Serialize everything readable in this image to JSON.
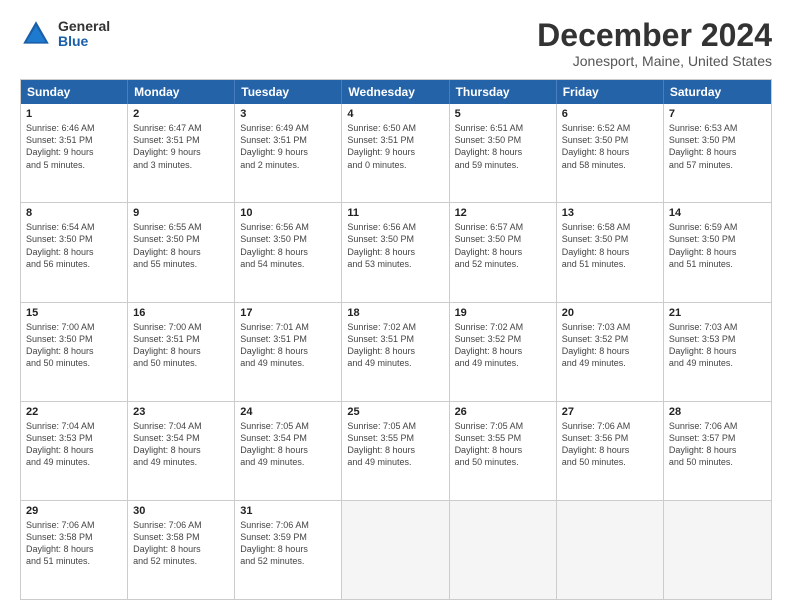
{
  "logo": {
    "general": "General",
    "blue": "Blue"
  },
  "title": "December 2024",
  "subtitle": "Jonesport, Maine, United States",
  "days": [
    "Sunday",
    "Monday",
    "Tuesday",
    "Wednesday",
    "Thursday",
    "Friday",
    "Saturday"
  ],
  "weeks": [
    [
      {
        "day": "1",
        "text": "Sunrise: 6:46 AM\nSunset: 3:51 PM\nDaylight: 9 hours\nand 5 minutes."
      },
      {
        "day": "2",
        "text": "Sunrise: 6:47 AM\nSunset: 3:51 PM\nDaylight: 9 hours\nand 3 minutes."
      },
      {
        "day": "3",
        "text": "Sunrise: 6:49 AM\nSunset: 3:51 PM\nDaylight: 9 hours\nand 2 minutes."
      },
      {
        "day": "4",
        "text": "Sunrise: 6:50 AM\nSunset: 3:51 PM\nDaylight: 9 hours\nand 0 minutes."
      },
      {
        "day": "5",
        "text": "Sunrise: 6:51 AM\nSunset: 3:50 PM\nDaylight: 8 hours\nand 59 minutes."
      },
      {
        "day": "6",
        "text": "Sunrise: 6:52 AM\nSunset: 3:50 PM\nDaylight: 8 hours\nand 58 minutes."
      },
      {
        "day": "7",
        "text": "Sunrise: 6:53 AM\nSunset: 3:50 PM\nDaylight: 8 hours\nand 57 minutes."
      }
    ],
    [
      {
        "day": "8",
        "text": "Sunrise: 6:54 AM\nSunset: 3:50 PM\nDaylight: 8 hours\nand 56 minutes."
      },
      {
        "day": "9",
        "text": "Sunrise: 6:55 AM\nSunset: 3:50 PM\nDaylight: 8 hours\nand 55 minutes."
      },
      {
        "day": "10",
        "text": "Sunrise: 6:56 AM\nSunset: 3:50 PM\nDaylight: 8 hours\nand 54 minutes."
      },
      {
        "day": "11",
        "text": "Sunrise: 6:56 AM\nSunset: 3:50 PM\nDaylight: 8 hours\nand 53 minutes."
      },
      {
        "day": "12",
        "text": "Sunrise: 6:57 AM\nSunset: 3:50 PM\nDaylight: 8 hours\nand 52 minutes."
      },
      {
        "day": "13",
        "text": "Sunrise: 6:58 AM\nSunset: 3:50 PM\nDaylight: 8 hours\nand 51 minutes."
      },
      {
        "day": "14",
        "text": "Sunrise: 6:59 AM\nSunset: 3:50 PM\nDaylight: 8 hours\nand 51 minutes."
      }
    ],
    [
      {
        "day": "15",
        "text": "Sunrise: 7:00 AM\nSunset: 3:50 PM\nDaylight: 8 hours\nand 50 minutes."
      },
      {
        "day": "16",
        "text": "Sunrise: 7:00 AM\nSunset: 3:51 PM\nDaylight: 8 hours\nand 50 minutes."
      },
      {
        "day": "17",
        "text": "Sunrise: 7:01 AM\nSunset: 3:51 PM\nDaylight: 8 hours\nand 49 minutes."
      },
      {
        "day": "18",
        "text": "Sunrise: 7:02 AM\nSunset: 3:51 PM\nDaylight: 8 hours\nand 49 minutes."
      },
      {
        "day": "19",
        "text": "Sunrise: 7:02 AM\nSunset: 3:52 PM\nDaylight: 8 hours\nand 49 minutes."
      },
      {
        "day": "20",
        "text": "Sunrise: 7:03 AM\nSunset: 3:52 PM\nDaylight: 8 hours\nand 49 minutes."
      },
      {
        "day": "21",
        "text": "Sunrise: 7:03 AM\nSunset: 3:53 PM\nDaylight: 8 hours\nand 49 minutes."
      }
    ],
    [
      {
        "day": "22",
        "text": "Sunrise: 7:04 AM\nSunset: 3:53 PM\nDaylight: 8 hours\nand 49 minutes."
      },
      {
        "day": "23",
        "text": "Sunrise: 7:04 AM\nSunset: 3:54 PM\nDaylight: 8 hours\nand 49 minutes."
      },
      {
        "day": "24",
        "text": "Sunrise: 7:05 AM\nSunset: 3:54 PM\nDaylight: 8 hours\nand 49 minutes."
      },
      {
        "day": "25",
        "text": "Sunrise: 7:05 AM\nSunset: 3:55 PM\nDaylight: 8 hours\nand 49 minutes."
      },
      {
        "day": "26",
        "text": "Sunrise: 7:05 AM\nSunset: 3:55 PM\nDaylight: 8 hours\nand 50 minutes."
      },
      {
        "day": "27",
        "text": "Sunrise: 7:06 AM\nSunset: 3:56 PM\nDaylight: 8 hours\nand 50 minutes."
      },
      {
        "day": "28",
        "text": "Sunrise: 7:06 AM\nSunset: 3:57 PM\nDaylight: 8 hours\nand 50 minutes."
      }
    ],
    [
      {
        "day": "29",
        "text": "Sunrise: 7:06 AM\nSunset: 3:58 PM\nDaylight: 8 hours\nand 51 minutes."
      },
      {
        "day": "30",
        "text": "Sunrise: 7:06 AM\nSunset: 3:58 PM\nDaylight: 8 hours\nand 52 minutes."
      },
      {
        "day": "31",
        "text": "Sunrise: 7:06 AM\nSunset: 3:59 PM\nDaylight: 8 hours\nand 52 minutes."
      },
      {
        "day": "",
        "text": ""
      },
      {
        "day": "",
        "text": ""
      },
      {
        "day": "",
        "text": ""
      },
      {
        "day": "",
        "text": ""
      }
    ]
  ]
}
